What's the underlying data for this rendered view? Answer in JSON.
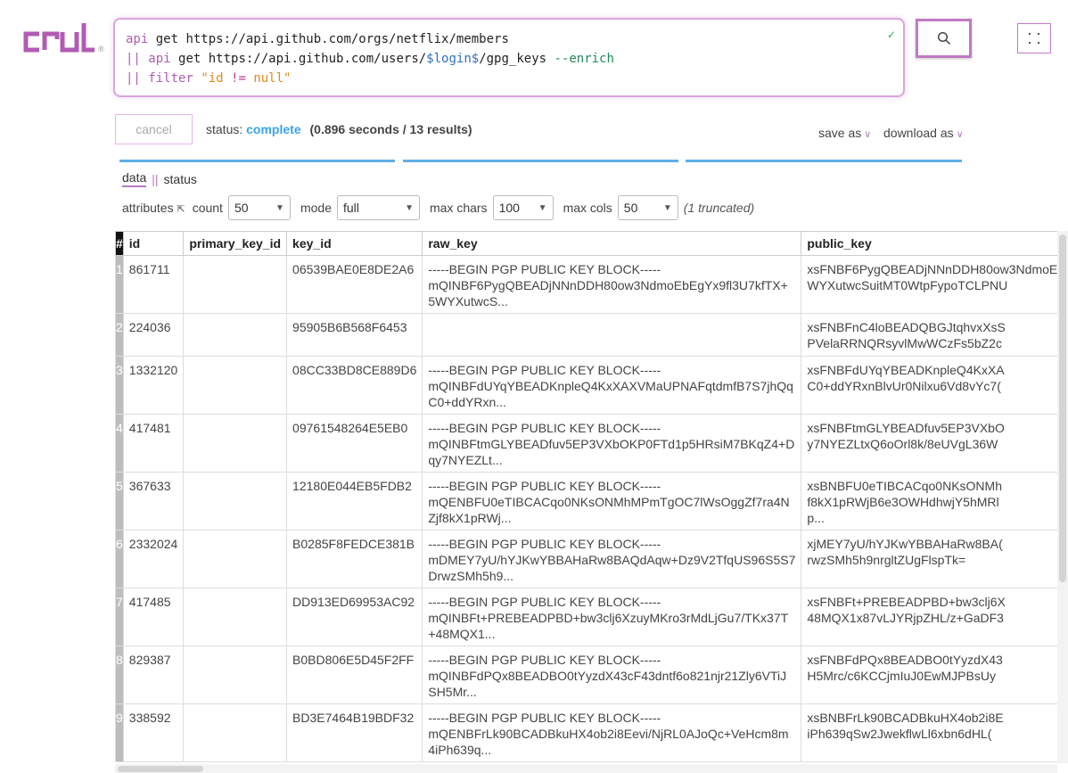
{
  "brand": {
    "logo_text": "crul",
    "registered": "®",
    "accent": "#b15bb4"
  },
  "query": {
    "line1": {
      "cmd": "api",
      "rest": " get https://api.github.com/orgs/netflix/members"
    },
    "line2": {
      "pipe": "|| ",
      "cmd": "api",
      "pre": " get https://api.github.com/users/",
      "var": "$login$",
      "post": "/gpg_keys ",
      "flag": "--enrich"
    },
    "line3": {
      "pipe": "|| ",
      "cmd": "filter",
      "sp": " ",
      "str": "\"id ",
      "op": "!=",
      "str2": " null\""
    },
    "valid_mark": "✓"
  },
  "toolbar": {
    "search_icon": "search-icon",
    "menu_icon": "grid-icon",
    "cancel_label": "cancel",
    "status_label": "status:",
    "status_value": "complete",
    "timing": "(0.896 seconds / 13 results)",
    "save_as": "save as",
    "download_as": "download as",
    "caret": "∨"
  },
  "tabs": {
    "data": "data",
    "sep": "||",
    "status": "status"
  },
  "controls": {
    "attributes_label": "attributes",
    "attributes_icon": "⇱",
    "count_label": "count",
    "count_value": "50",
    "mode_label": "mode",
    "mode_value": "full",
    "max_chars_label": "max chars",
    "max_chars_value": "100",
    "max_cols_label": "max cols",
    "max_cols_value": "50",
    "truncated_note": "(1 truncated)"
  },
  "table": {
    "columns": [
      "#",
      "id",
      "primary_key_id",
      "key_id",
      "raw_key",
      "public_key"
    ],
    "rows": [
      {
        "n": "1",
        "id": "861711",
        "primary_key_id": "",
        "key_id": "06539BAE0E8DE2A6",
        "raw_key": [
          "-----BEGIN PGP PUBLIC KEY BLOCK-----",
          "mQINBF6PygQBEADjNNnDDH80ow3NdmoEbEgYx9fl3U7kfTX+",
          "5WYXutwcS..."
        ],
        "public_key": [
          "xsFNBF6PygQBEADjNNnDDH80ow3NdmoEbEgYx9fl3U7kfTX+",
          "WYXutwcSuitMT0WtpFypoTCLPNU"
        ]
      },
      {
        "n": "2",
        "id": "224036",
        "primary_key_id": "",
        "key_id": "95905B6B568F6453",
        "raw_key": [],
        "public_key": [
          "xsFNBFnC4loBEADQBGJtqhvxXsS",
          "PVelaRRNQRsyvlMwWCzFs5bZ2c"
        ]
      },
      {
        "n": "3",
        "id": "1332120",
        "primary_key_id": "",
        "key_id": "08CC33BD8CE889D6",
        "raw_key": [
          "-----BEGIN PGP PUBLIC KEY BLOCK-----",
          "mQINBFdUYqYBEADKnpleQ4KxXAXVMaUPNAFqtdmfB7S7jhQq",
          "C0+ddYRxn..."
        ],
        "public_key": [
          "xsFNBFdUYqYBEADKnpleQ4KxXA",
          "C0+ddYRxnBlvUr0Nilxu6Vd8vYc7("
        ]
      },
      {
        "n": "4",
        "id": "417481",
        "primary_key_id": "",
        "key_id": "09761548264E5EB0",
        "raw_key": [
          "-----BEGIN PGP PUBLIC KEY BLOCK-----",
          "mQINBFtmGLYBEADfuv5EP3VXbOKP0FTd1p5HRsiM7BKqZ4+D",
          "qy7NYEZLt..."
        ],
        "public_key": [
          "xsFNBFtmGLYBEADfuv5EP3VXbO",
          "y7NYEZLtxQ6oOrl8k/8eUVgL36W"
        ]
      },
      {
        "n": "5",
        "id": "367633",
        "primary_key_id": "",
        "key_id": "12180E044EB5FDB2",
        "raw_key": [
          "-----BEGIN PGP PUBLIC KEY BLOCK-----",
          "mQENBFU0eTIBCACqo0NKsONMhMPmTgOC7lWsOggZf7ra4N",
          "Zjf8kX1pRWj..."
        ],
        "public_key": [
          "xsBNBFU0eTIBCACqo0NKsONMh",
          "f8kX1pRWjB6e3OWHdhwjY5hMRl",
          "p..."
        ]
      },
      {
        "n": "6",
        "id": "2332024",
        "primary_key_id": "",
        "key_id": "B0285F8FEDCE381B",
        "raw_key": [
          "-----BEGIN PGP PUBLIC KEY BLOCK-----",
          "mDMEY7yU/hYJKwYBBAHaRw8BAQdAqw+Dz9V2TfqUS96S5S7",
          "DrwzSMh5h9..."
        ],
        "public_key": [
          "xjMEY7yU/hYJKwYBBAHaRw8BA(",
          "rwzSMh5h9nrgltZUgFlspTk="
        ]
      },
      {
        "n": "7",
        "id": "417485",
        "primary_key_id": "",
        "key_id": "DD913ED69953AC92",
        "raw_key": [
          "-----BEGIN PGP PUBLIC KEY BLOCK-----",
          "mQINBFt+PREBEADPBD+bw3clj6XzuyMKro3rMdLjGu7/TKx37T",
          "+48MQX1..."
        ],
        "public_key": [
          "xsFNBFt+PREBEADPBD+bw3clj6X",
          "48MQX1x87vLJYRjpZHL/z+GaDF3"
        ]
      },
      {
        "n": "8",
        "id": "829387",
        "primary_key_id": "",
        "key_id": "B0BD806E5D45F2FF",
        "raw_key": [
          "-----BEGIN PGP PUBLIC KEY BLOCK-----",
          "mQINBFdPQx8BEADBO0tYyzdX43cF43dntf6o821njr21Zly6VTiJ",
          "SH5Mr..."
        ],
        "public_key": [
          "xsFNBFdPQx8BEADBO0tYyzdX43",
          "H5Mrc/c6KCCjmIuJ0EwMJPBsUy"
        ]
      },
      {
        "n": "9",
        "id": "338592",
        "primary_key_id": "",
        "key_id": "BD3E7464B19BDF32",
        "raw_key": [
          "-----BEGIN PGP PUBLIC KEY BLOCK-----",
          "mQENBFrLk90BCADBkuHX4ob2i8Eevi/NjRL0AJoQc+VeHcm8m",
          "4iPh639q..."
        ],
        "public_key": [
          "xsBNBFrLk90BCADBkuHX4ob2i8E",
          "iPh639qSw2JwekflwLl6xbn6dHL("
        ]
      }
    ]
  },
  "colors": {
    "accent_purple": "#b15bb4",
    "status_blue": "#3ba3e8",
    "bar_blue": "#61aee8"
  }
}
